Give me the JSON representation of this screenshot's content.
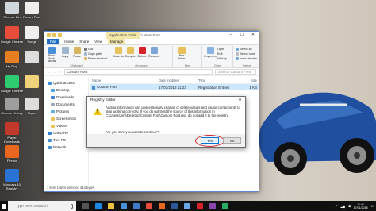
{
  "desktop": {
    "icons": [
      {
        "label": "Recycle Bin",
        "color": "#cfd8dc"
      },
      {
        "label": "Google Chrome",
        "color": "#e74c3c"
      },
      {
        "label": "My Blog",
        "color": "#e67e22"
      },
      {
        "label": "Google Chrome",
        "color": "#2ecc71"
      },
      {
        "label": "Chrome History",
        "color": "#9e9e9e"
      },
      {
        "label": "Player Downloads",
        "color": "#c0392b"
      },
      {
        "label": "Firefox",
        "color": "#e8661e"
      },
      {
        "label": "Windows 10 Registry",
        "color": "#2b72d7"
      }
    ],
    "icons_col2": [
      {
        "label": "Recent Post",
        "color": "#eeeeee"
      },
      {
        "label": "Songs",
        "color": "#eeeeee"
      },
      {
        "label": "",
        "color": "#dddddd"
      },
      {
        "label": "",
        "color": "#f0d27a"
      },
      {
        "label": "Skype",
        "color": "#dddddd"
      }
    ]
  },
  "explorer": {
    "window_title": "Custom Font",
    "app_tools": "Application Tools",
    "tabs": [
      "File",
      "Home",
      "Share",
      "View",
      "Manage"
    ],
    "ribbon": {
      "pin_label": "Pin to Quick access",
      "copy_label": "Copy",
      "paste_label": "Paste",
      "cut_label": "Cut",
      "copy_path_label": "Copy path",
      "paste_shortcut_label": "Paste shortcut",
      "clipboard_group": "Clipboard",
      "move_to_label": "Move to",
      "copy_to_label": "Copy to",
      "delete_label": "Delete",
      "rename_label": "Rename",
      "organize_group": "Organize",
      "new_folder_label": "New folder",
      "new_group": "New",
      "properties_label": "Properties",
      "open_label": "Open",
      "edit_label": "Edit",
      "history_label": "History",
      "open_group": "Open",
      "select_all_label": "Select all",
      "select_none_label": "Select none",
      "invert_selection_label": "Invert selection",
      "select_group": "Select"
    },
    "address": "Custom Font",
    "search_placeholder": "Search Custom Font",
    "nav": [
      {
        "label": "Quick access",
        "color": "#3b8ee0",
        "head": true
      },
      {
        "label": "Desktop",
        "color": "#4aa3e8"
      },
      {
        "label": "Downloads",
        "color": "#3d7cc9"
      },
      {
        "label": "Documents",
        "color": "#9aa8b8"
      },
      {
        "label": "Pictures",
        "color": "#5fb0e0"
      },
      {
        "label": "Screenshots",
        "color": "#e8c15a"
      },
      {
        "label": "Videos",
        "color": "#e8c15a"
      },
      {
        "label": "OneDrive",
        "color": "#2f7fd7",
        "head": true
      },
      {
        "label": "This PC",
        "color": "#4a90d9",
        "head": true
      },
      {
        "label": "Network",
        "color": "#4a90d9",
        "head": true
      }
    ],
    "columns": [
      "Name",
      "Date modified",
      "Type",
      "Size"
    ],
    "files": [
      {
        "name": "Custom Font",
        "date": "17/01/2018 11:23",
        "type": "Registration Entries",
        "size": "1 KB"
      }
    ],
    "status": "1 item    1 item selected  414 bytes"
  },
  "dialog": {
    "title": "Registry Editor",
    "message": "Adding information can unintentionally change or delete values and cause components to stop working correctly. If you do not trust the source of this information in C:\\Users\\Jimi\\Desktop\\Custom Font\\Custom Font.reg, do not add it to the registry.",
    "question": "Are you sure you want to continue?",
    "yes": "Yes",
    "no": "No",
    "highlight_color": "#d6232a"
  },
  "taskbar": {
    "search_placeholder": "Type here to search",
    "time": "11:41",
    "date": "17/01/2018",
    "icons": [
      {
        "name": "task-view-icon",
        "color": "#555555"
      },
      {
        "name": "edge-icon",
        "color": "#1e88e5"
      },
      {
        "name": "explorer-icon",
        "color": "#f0c040"
      },
      {
        "name": "store-icon",
        "color": "#4a90d9"
      },
      {
        "name": "mail-icon",
        "color": "#3d7cc9"
      },
      {
        "name": "chrome-icon",
        "color": "#e74c3c"
      },
      {
        "name": "firefox-icon",
        "color": "#e8661e"
      },
      {
        "name": "word-icon",
        "color": "#2b579a"
      },
      {
        "name": "photos-icon",
        "color": "#6aa9e8"
      },
      {
        "name": "media-icon",
        "color": "#d6232a"
      },
      {
        "name": "music-icon",
        "color": "#8e44ad"
      },
      {
        "name": "app-icon",
        "color": "#27ae60"
      }
    ]
  }
}
